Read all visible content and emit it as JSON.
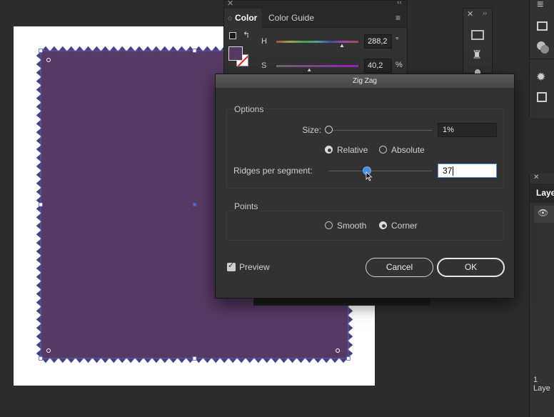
{
  "canvas": {
    "artboard_color": "#ffffff",
    "shape_fill": "#573a64",
    "selection_color": "#4a6bd8"
  },
  "color_panel": {
    "tabs": [
      {
        "label": "Color",
        "active": true
      },
      {
        "label": "Color Guide",
        "active": false
      }
    ],
    "fill_swatch": "#573a64",
    "channels": [
      {
        "label": "H",
        "value": "288,2",
        "unit": "°",
        "slider": 0.8
      },
      {
        "label": "S",
        "value": "40,2",
        "unit": "%",
        "slider": 0.402
      }
    ]
  },
  "layers_panel": {
    "title": "Laye",
    "footer": "1 Laye"
  },
  "dialog": {
    "title": "Zig Zag",
    "options_group": {
      "label": "Options",
      "size_label": "Size:",
      "size_value": "1%",
      "size_slider": 0.0,
      "size_mode": [
        {
          "label": "Relative",
          "checked": true
        },
        {
          "label": "Absolute",
          "checked": false
        }
      ],
      "ridges_label": "Ridges per segment:",
      "ridges_value": "37",
      "ridges_slider": 0.37
    },
    "points_group": {
      "label": "Points",
      "options": [
        {
          "label": "Smooth",
          "checked": false
        },
        {
          "label": "Corner",
          "checked": true
        }
      ]
    },
    "preview_label": "Preview",
    "preview_checked": true,
    "cancel_label": "Cancel",
    "ok_label": "OK"
  }
}
